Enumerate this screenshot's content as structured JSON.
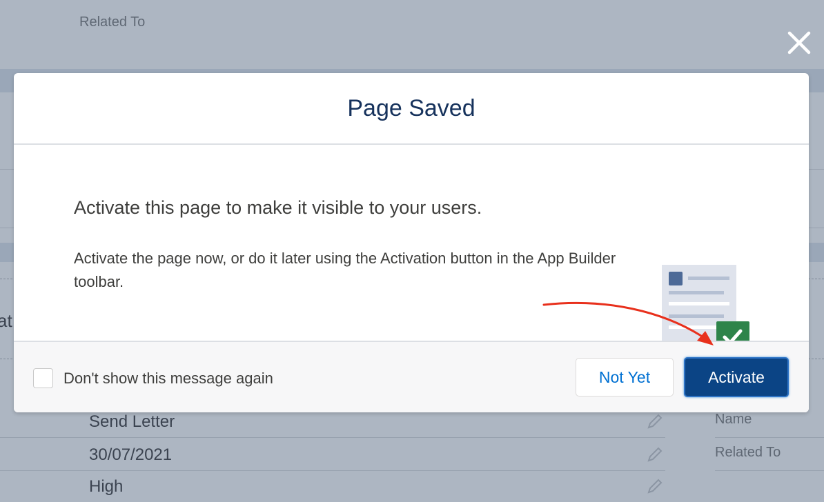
{
  "background": {
    "related_to_top": "Related To",
    "partial_text": "at",
    "fields": [
      "Send Letter",
      "30/07/2021",
      "High"
    ],
    "right_labels": [
      "Name",
      "Related To"
    ]
  },
  "modal": {
    "title": "Page Saved",
    "headline": "Activate this page to make it visible to your users.",
    "description": "Activate the page now, or do it later using the Activation button in the App Builder toolbar.",
    "checkbox_label": "Don't show this message again",
    "checkbox_checked": false,
    "not_yet_label": "Not Yet",
    "activate_label": "Activate"
  },
  "icons": {
    "close": "close-icon",
    "illustration": "page-activated-illustration",
    "check": "checkmark-icon",
    "pencil": "pencil-edit-icon",
    "annotation": "red-arrow-annotation"
  },
  "colors": {
    "overlay": "#adb6c2",
    "title": "#16325c",
    "brand_button": "#0b4485",
    "link": "#0070d2",
    "success": "#2e844a",
    "annotation": "#e8301c"
  }
}
